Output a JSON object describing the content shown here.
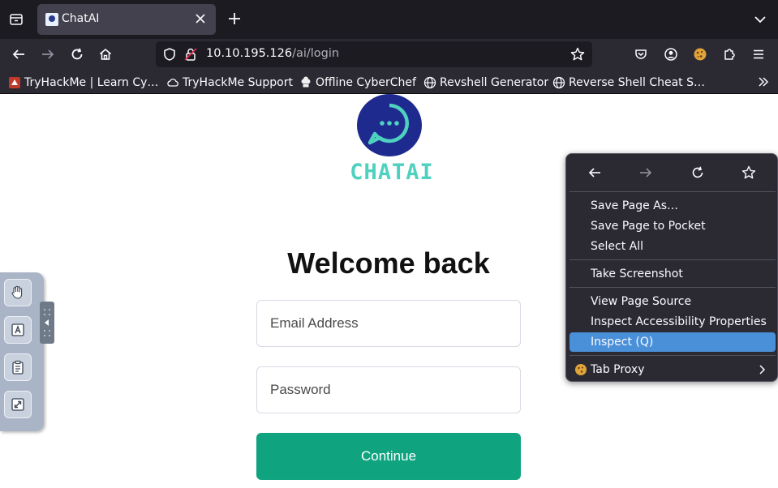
{
  "browser": {
    "tab": {
      "title": "ChatAI"
    },
    "url": {
      "host": "10.10.195.126",
      "path": "/ai/login"
    },
    "bookmarks": [
      {
        "label": "TryHackMe | Learn Cy…",
        "icon": "tryhackme-icon"
      },
      {
        "label": "TryHackMe Support",
        "icon": "cloud-icon"
      },
      {
        "label": "Offline CyberChef",
        "icon": "chef-hat-icon"
      },
      {
        "label": "Revshell Generator",
        "icon": "globe-icon"
      },
      {
        "label": "Reverse Shell Cheat S…",
        "icon": "globe-icon"
      }
    ]
  },
  "page": {
    "logo_text": "CHATAI",
    "heading": "Welcome back",
    "email_placeholder": "Email Address",
    "password_placeholder": "Password",
    "continue_label": "Continue"
  },
  "context_menu": {
    "items": [
      {
        "label": "Save Page As…"
      },
      {
        "label": "Save Page to Pocket"
      },
      {
        "label": "Select All"
      },
      {
        "label": "Take Screenshot"
      },
      {
        "label": "View Page Source"
      },
      {
        "label": "Inspect Accessibility Properties"
      },
      {
        "label": "Inspect (Q)"
      },
      {
        "label": "Tab Proxy"
      }
    ]
  },
  "colors": {
    "brand_teal": "#4fd1bf",
    "logo_navy": "#1e2a8e",
    "continue_green": "#10a37f",
    "menu_highlight": "#4a90d9"
  }
}
